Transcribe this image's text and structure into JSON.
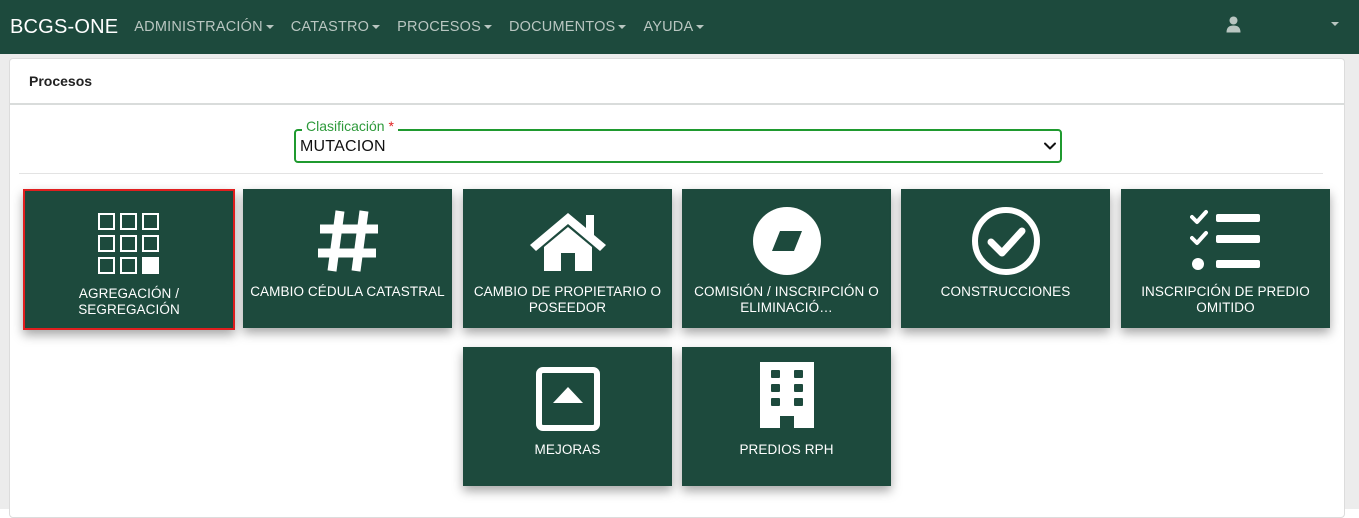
{
  "navbar": {
    "brand": "BCGS-ONE",
    "menu": [
      {
        "label": "ADMINISTRACIÓN"
      },
      {
        "label": "CATASTRO"
      },
      {
        "label": "PROCESOS"
      },
      {
        "label": "DOCUMENTOS"
      },
      {
        "label": "AYUDA"
      }
    ],
    "user_icon": "user-icon"
  },
  "card": {
    "title": "Procesos"
  },
  "classification": {
    "label": "Clasificación",
    "required_mark": "*",
    "value": "MUTACION"
  },
  "tiles": [
    {
      "label": "AGREGACIÓN / SEGREGACIÓN",
      "icon": "grid-icon",
      "selected": true
    },
    {
      "label": "CAMBIO CÉDULA CATASTRAL",
      "icon": "hash-icon"
    },
    {
      "label": "CAMBIO DE PROPIETARIO O POSEEDOR",
      "icon": "home-icon"
    },
    {
      "label": "COMISIÓN / INSCRIPCIÓN O ELIMINACIÓ…",
      "icon": "parallelogram-circle-icon"
    },
    {
      "label": "CONSTRUCCIONES",
      "icon": "check-circle-icon"
    },
    {
      "label": "INSCRIPCIÓN DE PREDIO OMITIDO",
      "icon": "checklist-icon"
    },
    {
      "label": "MEJORAS",
      "icon": "eject-box-icon"
    },
    {
      "label": "PREDIOS RPH",
      "icon": "building-icon"
    }
  ],
  "colors": {
    "primary": "#1d4a3d",
    "field_border": "#1f9a2f",
    "selected_border": "#e01f1f"
  }
}
